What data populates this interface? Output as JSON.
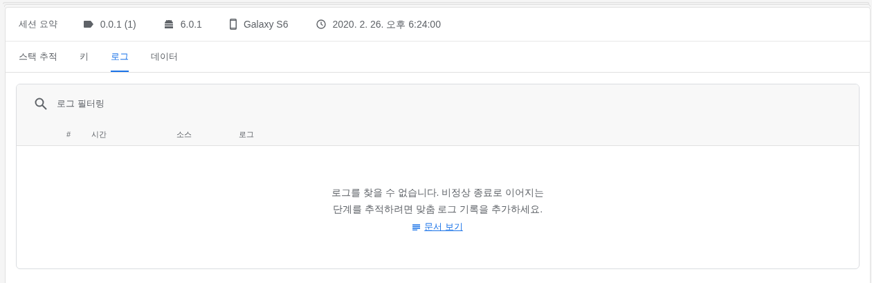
{
  "summary": {
    "title": "세션 요약",
    "items": [
      {
        "kind": "version",
        "text": "0.0.1 (1)"
      },
      {
        "kind": "os",
        "text": "6.0.1"
      },
      {
        "kind": "device",
        "text": "Galaxy S6"
      },
      {
        "kind": "time",
        "text": "2020. 2. 26. 오후 6:24:00"
      }
    ]
  },
  "tabs": [
    {
      "label": "스택 추적",
      "selected": false
    },
    {
      "label": "키",
      "selected": false
    },
    {
      "label": "로그",
      "selected": true
    },
    {
      "label": "데이터",
      "selected": false
    }
  ],
  "logs": {
    "search": {
      "placeholder": "로그 필터링"
    },
    "columns": [
      "#",
      "시간",
      "소스",
      "로그"
    ],
    "empty_message": [
      "로그를 찾을 수 없습니다. 비정상 종료로 이어지는",
      "단계를 추적하려면 맞춤 로그 기록을 추가하세요."
    ],
    "docs_link": "문서 보기"
  }
}
